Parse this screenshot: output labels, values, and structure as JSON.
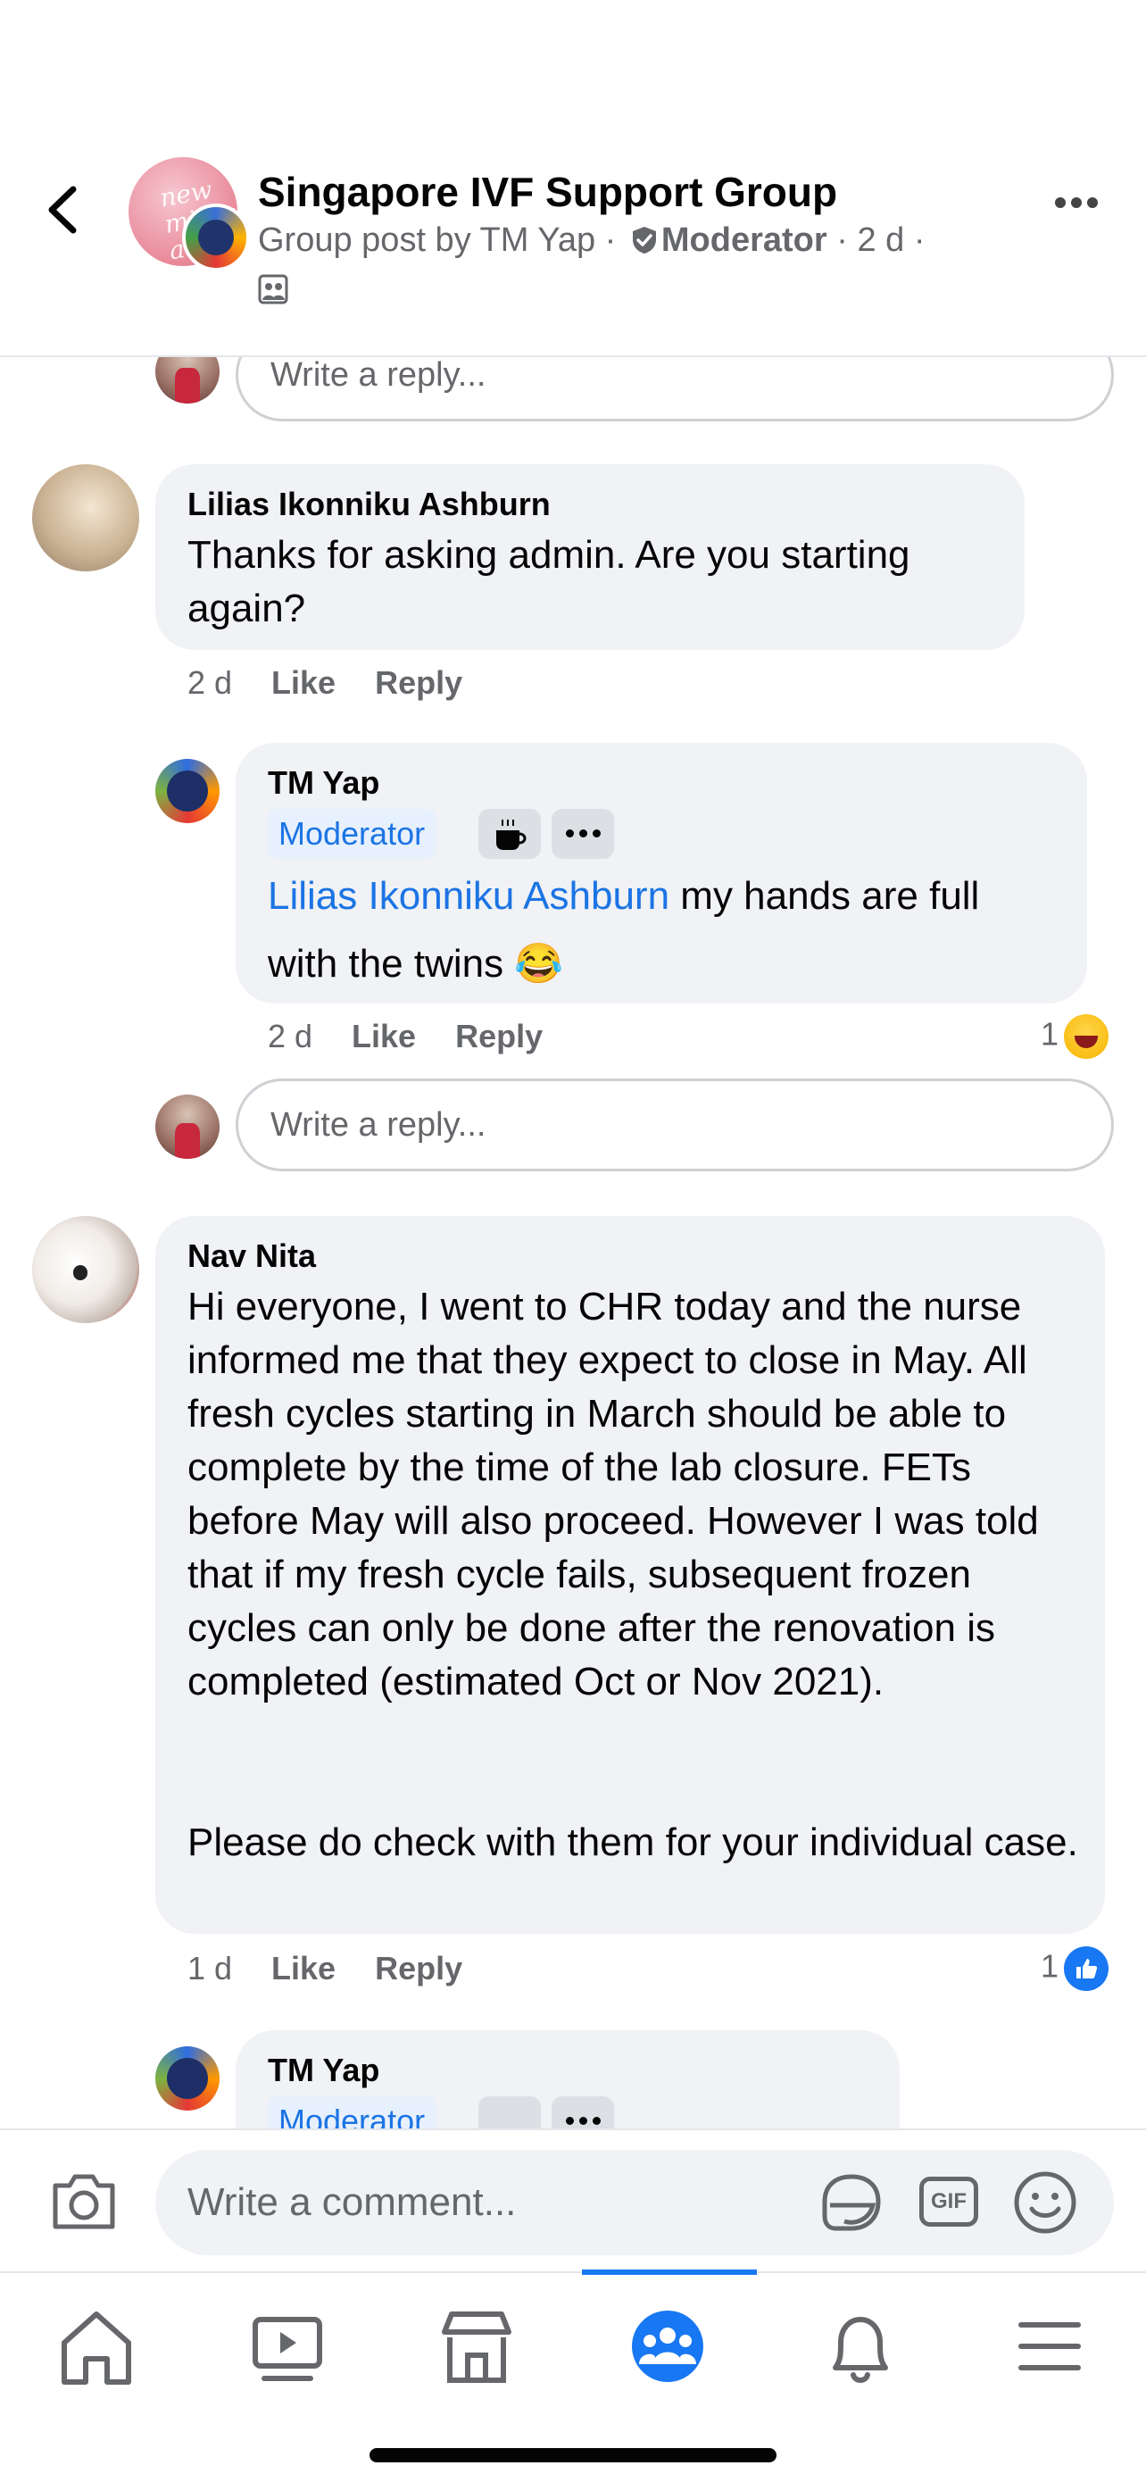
{
  "header": {
    "group_name": "Singapore IVF Support Group",
    "post_by": "Group post by TM Yap",
    "separator": "·",
    "role": "Moderator",
    "time": "2 d",
    "avatar_text": "new miracle a life"
  },
  "thread": {
    "reply_placeholder": "Write a reply...",
    "comments": [
      {
        "author": "Lilias Ikonniku Ashburn",
        "text": "Thanks for asking admin. Are you starting again?",
        "time": "2 d",
        "like": "Like",
        "reply": "Reply"
      },
      {
        "author": "TM Yap",
        "badge": "Moderator",
        "mention": "Lilias Ikonniku Ashburn",
        "text": " my hands are full with the twins 😂",
        "time": "2 d",
        "like": "Like",
        "reply": "Reply",
        "reaction_count": "1",
        "reaction": "haha"
      },
      {
        "author": "Nav Nita",
        "text": "Hi everyone, I went to CHR today and the nurse informed me that they expect to close in May. All fresh cycles starting in March should be able to complete by the time of the lab closure. FETs before May will also proceed. However I was told that if my fresh cycle fails, subsequent frozen cycles can only be done after the renovation is completed (estimated Oct or Nov 2021).",
        "text2": "Please do check with them for your individual case.",
        "time": "1 d",
        "like": "Like",
        "reply": "Reply",
        "reaction_count": "1",
        "reaction": "like"
      },
      {
        "author": "TM Yap",
        "badge": "Moderator"
      }
    ]
  },
  "composer": {
    "placeholder": "Write a comment...",
    "gif_label": "GIF"
  },
  "tabs": [
    {
      "name": "home",
      "icon": "home-icon"
    },
    {
      "name": "watch",
      "icon": "video-icon"
    },
    {
      "name": "marketplace",
      "icon": "store-icon"
    },
    {
      "name": "groups",
      "icon": "groups-icon",
      "active": true
    },
    {
      "name": "notifications",
      "icon": "bell-icon"
    },
    {
      "name": "menu",
      "icon": "menu-icon"
    }
  ],
  "colors": {
    "accent": "#1877f2",
    "bubble": "#f0f2f5",
    "secondary_text": "#65676b"
  }
}
